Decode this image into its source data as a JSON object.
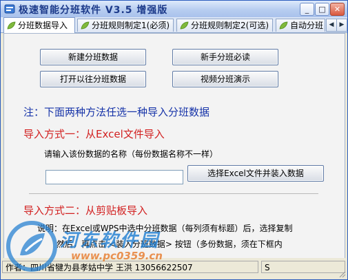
{
  "window": {
    "title": "极速智能分班软件 V3.5 增强版",
    "buttons": {
      "minimize": "_",
      "maximize": "□",
      "close": "✕"
    }
  },
  "tabs": [
    {
      "label": "分班数据导入",
      "active": true
    },
    {
      "label": "分班规则制定1(必须)",
      "active": false
    },
    {
      "label": "分班规则制定2(可选)",
      "active": false
    },
    {
      "label": "自动分班",
      "active": false
    }
  ],
  "tab_scroll": {
    "left": "◀",
    "right": "▶"
  },
  "buttons": {
    "new_data": "新建分班数据",
    "beginner_guide": "新手分班必读",
    "open_previous": "打开以往分班数据",
    "video_demo": "视频分班演示",
    "load_excel": "选择Excel文件并装入数据"
  },
  "note": "注：下面两种方法任选一种导入分班数据",
  "method1": {
    "heading": "导入方式一：从Excel文件导入",
    "prompt": "请输入该份数据的名称（每份数据名称不一样）",
    "name_value": ""
  },
  "method2": {
    "heading": "导入方式二：从剪贴板导入",
    "line1": "说明：在Excel或WPS中选中分班数据（每列须有标题）后，选择复制",
    "line2": "然后，再点击 <装入分班数据> 按钮（多份数据，须在下框内"
  },
  "statusbar": {
    "author": "作者：四川省犍为县孝姑中学 王洪  13056622507",
    "right": "S"
  },
  "watermark": {
    "text": "河东软件园",
    "url": "www.pc0359.cn"
  },
  "colors": {
    "accent_blue": "#1633a8",
    "accent_red": "#d22020",
    "title_blue": "#1c3a8a"
  }
}
